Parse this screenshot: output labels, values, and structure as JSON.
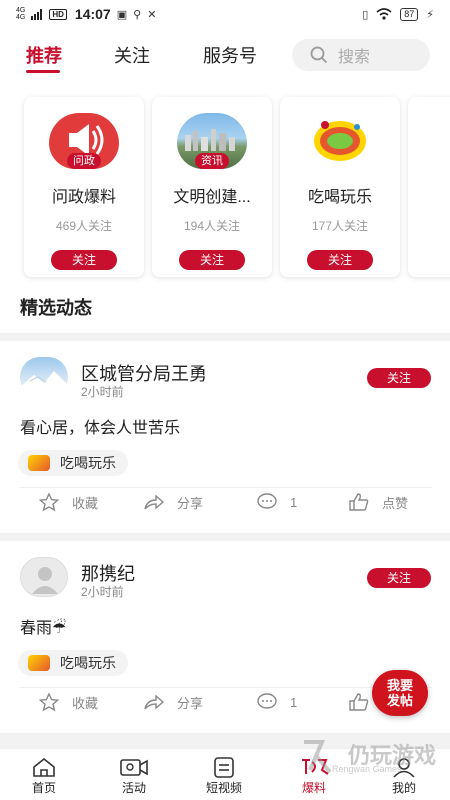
{
  "status_bar": {
    "signal": "4G",
    "signal2": "4G",
    "hd": "HD",
    "time": "14:07",
    "battery": "87"
  },
  "nav": {
    "tabs": [
      "推荐",
      "关注",
      "服务号"
    ],
    "active_tab": "推荐",
    "search_placeholder": "搜索"
  },
  "service_cards": [
    {
      "name": "问政爆料",
      "badge": "问政",
      "fans": "469人关注",
      "follow": "关注"
    },
    {
      "name": "文明创建...",
      "badge": "资讯",
      "fans": "194人关注",
      "follow": "关注"
    },
    {
      "name": "吃喝玩乐",
      "badge": "",
      "fans": "177人关注",
      "follow": "关注"
    }
  ],
  "section_title": "精选动态",
  "posts": [
    {
      "author": "区城管分局王勇",
      "time": "2小时前",
      "follow": "关注",
      "content": "看心居，体会人世苦乐",
      "topic": "吃喝玩乐",
      "actions": {
        "collect": "收藏",
        "share": "分享",
        "comments": "1",
        "like": "点赞"
      }
    },
    {
      "author": "那携纪",
      "time": "2小时前",
      "follow": "关注",
      "content": "春雨☔",
      "topic": "吃喝玩乐",
      "actions": {
        "collect": "收藏",
        "share": "分享",
        "comments": "1",
        "like": "点赞"
      }
    }
  ],
  "fab": {
    "line1": "我要",
    "line2": "发帖"
  },
  "bottom_nav": [
    {
      "label": "首页",
      "icon": "home-icon"
    },
    {
      "label": "活动",
      "icon": "video-camera-icon"
    },
    {
      "label": "短视频",
      "icon": "short-video-icon"
    },
    {
      "label": "爆料",
      "icon": "wenzheng-logo-icon",
      "active": true
    },
    {
      "label": "我的",
      "icon": "profile-icon"
    }
  ],
  "watermark": {
    "main": "仍玩游戏",
    "sub": "Rengwan Games"
  },
  "colors": {
    "accent": "#c8102e",
    "muted": "#888888",
    "divider": "#f2f2f2"
  }
}
